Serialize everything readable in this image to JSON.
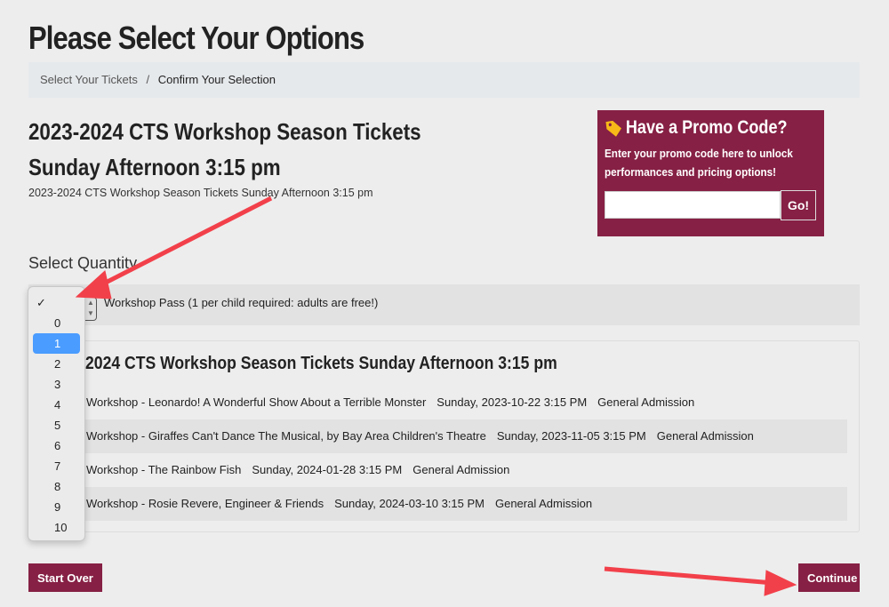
{
  "page_title": "Please Select Your Options",
  "breadcrumb": [
    "Select Your Tickets",
    "Confirm Your Selection"
  ],
  "product": {
    "title": "2023-2024 CTS Workshop Season Tickets Sunday Afternoon 3:15 pm",
    "subtitle": "2023-2024 CTS Workshop Season Tickets Sunday Afternoon 3:15 pm"
  },
  "promo": {
    "heading": "Have a Promo Code?",
    "text1": "Enter your promo code here to unlock",
    "text2": "performances and pricing options!",
    "input_value": "",
    "go_label": "Go!",
    "icon": "tag-icon",
    "color": "#862044"
  },
  "quantity": {
    "label": "Select Quantity",
    "item_label": "Workshop Pass (1 per child required: adults are free!)",
    "selected": "1",
    "options": [
      "0",
      "1",
      "2",
      "3",
      "4",
      "5",
      "6",
      "7",
      "8",
      "9",
      "10"
    ]
  },
  "package": {
    "title": "2024 CTS Workshop Season Tickets Sunday Afternoon 3:15 pm",
    "events": [
      {
        "name": "Workshop - Leonardo! A Wonderful Show About a Terrible Monster",
        "date": "Sunday, 2023-10-22 3:15 PM",
        "seating": "General Admission"
      },
      {
        "name": "Workshop - Giraffes Can't Dance The Musical, by Bay Area Children's Theatre",
        "date": "Sunday, 2023-11-05 3:15 PM",
        "seating": "General Admission"
      },
      {
        "name": "Workshop - The Rainbow Fish",
        "date": "Sunday, 2024-01-28 3:15 PM",
        "seating": "General Admission"
      },
      {
        "name": "Workshop - Rosie Revere, Engineer & Friends",
        "date": "Sunday, 2024-03-10 3:15 PM",
        "seating": "General Admission"
      }
    ]
  },
  "buttons": {
    "start_over": "Start Over",
    "continue": "Continue"
  }
}
